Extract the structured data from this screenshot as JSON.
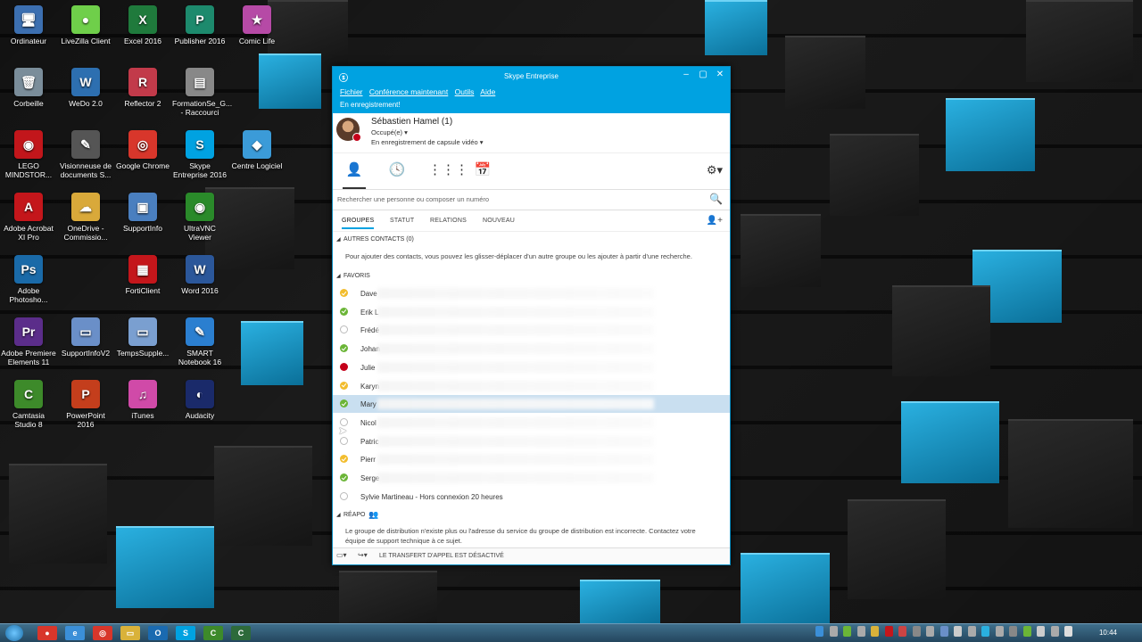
{
  "desktop": {
    "icons": [
      {
        "label": "Ordinateur",
        "glyph": "🖥",
        "color": "#3c6fb0"
      },
      {
        "label": "LiveZilla Client",
        "glyph": "●",
        "color": "#6fcf4a"
      },
      {
        "label": "Excel 2016",
        "glyph": "X",
        "color": "#1f7a3c"
      },
      {
        "label": "Publisher 2016",
        "glyph": "P",
        "color": "#1d8a6d"
      },
      {
        "label": "Comic Life",
        "glyph": "★",
        "color": "#b64aa6"
      },
      {
        "label": "Corbeille",
        "glyph": "🗑",
        "color": "#7a8d9a"
      },
      {
        "label": "WeDo 2.0",
        "glyph": "W",
        "color": "#2d6fb0"
      },
      {
        "label": "Reflector 2",
        "glyph": "R",
        "color": "#c23a4a"
      },
      {
        "label": "FormationSe_G... - Raccourci",
        "glyph": "▤",
        "color": "#888"
      },
      {
        "label": "LEGO MINDSTOR...",
        "glyph": "◉",
        "color": "#c2161b"
      },
      {
        "label": "Visionneuse de documents S...",
        "glyph": "✎",
        "color": "#555"
      },
      {
        "label": "Google Chrome",
        "glyph": "◎",
        "color": "#d8362b"
      },
      {
        "label": "Skype Entreprise 2016",
        "glyph": "S",
        "color": "#00a2e1"
      },
      {
        "label": "Centre Logiciel",
        "glyph": "◆",
        "color": "#3b9bd8"
      },
      {
        "label": "Adobe Acrobat XI Pro",
        "glyph": "A",
        "color": "#c4161b"
      },
      {
        "label": "OneDrive - Commissio...",
        "glyph": "☁",
        "color": "#d9a93a"
      },
      {
        "label": "SupportInfo",
        "glyph": "▣",
        "color": "#4a7fbf"
      },
      {
        "label": "UltraVNC Viewer",
        "glyph": "◉",
        "color": "#2a8a2a"
      },
      {
        "label": "Adobe Photosho...",
        "glyph": "Ps",
        "color": "#1a6aa8"
      },
      {
        "label": "FortiClient",
        "glyph": "▦",
        "color": "#c4161b"
      },
      {
        "label": "Word 2016",
        "glyph": "W",
        "color": "#2b579a"
      },
      {
        "label": "Adobe Premiere Elements 11",
        "glyph": "Pr",
        "color": "#5b2d8a"
      },
      {
        "label": "SupportInfoV2",
        "glyph": "▭",
        "color": "#6a8fc8"
      },
      {
        "label": "TempsSupple...",
        "glyph": "▭",
        "color": "#7a9fd0"
      },
      {
        "label": "SMART Notebook 16",
        "glyph": "✎",
        "color": "#2b7fd0"
      },
      {
        "label": "Camtasia Studio 8",
        "glyph": "C",
        "color": "#3d8a2a"
      },
      {
        "label": "PowerPoint 2016",
        "glyph": "P",
        "color": "#c43e1c"
      },
      {
        "label": "iTunes",
        "glyph": "♫",
        "color": "#d04aa8"
      },
      {
        "label": "Audacity",
        "glyph": "◐",
        "color": "#1a2a6a"
      }
    ]
  },
  "window": {
    "title": "Skype Entreprise",
    "menu": [
      "Fichier",
      "Conférence maintenant",
      "Outils",
      "Aide"
    ],
    "recording_banner": "En enregistrement!",
    "profile": {
      "name": "Sébastien Hamel (1)",
      "status": "Occupé(e) ▾",
      "note": "En enregistrement de capsule vidéo ▾"
    },
    "search_placeholder": "Rechercher une personne ou composer un numéro",
    "filters": [
      "GROUPES",
      "STATUT",
      "RELATIONS",
      "NOUVEAU"
    ],
    "groups": {
      "autres": "AUTRES CONTACTS (0)",
      "autres_msg": "Pour ajouter des contacts, vous pouvez les glisser-déplacer d'un autre groupe ou les ajouter à partir d'une recherche.",
      "favoris": "FAVORIS",
      "reapo": "RÉAPO",
      "reapo_msg": "Le groupe de distribution n'existe plus ou l'adresse du service du groupe de distribution est incorrecte. Contactez votre équipe de support technique à ce sujet."
    },
    "contacts": [
      {
        "name": "Dave",
        "presence": "yellow"
      },
      {
        "name": "Erik L",
        "presence": "green"
      },
      {
        "name": "Frédé",
        "presence": "off"
      },
      {
        "name": "Johan",
        "presence": "green"
      },
      {
        "name": "Julie",
        "presence": "red"
      },
      {
        "name": "Karyn",
        "presence": "yellow"
      },
      {
        "name": "Mary",
        "presence": "green"
      },
      {
        "name": "Nicol",
        "presence": "off"
      },
      {
        "name": "Patric",
        "presence": "off"
      },
      {
        "name": "Pierr",
        "presence": "yellow"
      },
      {
        "name": "Serge",
        "presence": "green"
      },
      {
        "name": "Sylvie Martineau - Hors connexion 20 heures",
        "presence": "off"
      }
    ],
    "statusbar": "LE TRANSFERT D'APPEL EST DÉSACTIVÉ"
  },
  "taskbar": {
    "clock": "10:44",
    "apps": [
      {
        "glyph": "●",
        "color": "#d8362b"
      },
      {
        "glyph": "e",
        "color": "#3b8fd8"
      },
      {
        "glyph": "◎",
        "color": "#d8362b"
      },
      {
        "glyph": "▭",
        "color": "#d9b23a"
      },
      {
        "glyph": "O",
        "color": "#1a6ab0"
      },
      {
        "glyph": "S",
        "color": "#00a2e1"
      },
      {
        "glyph": "C",
        "color": "#3d8a2a"
      },
      {
        "glyph": "C",
        "color": "#2d6a3a"
      }
    ]
  }
}
